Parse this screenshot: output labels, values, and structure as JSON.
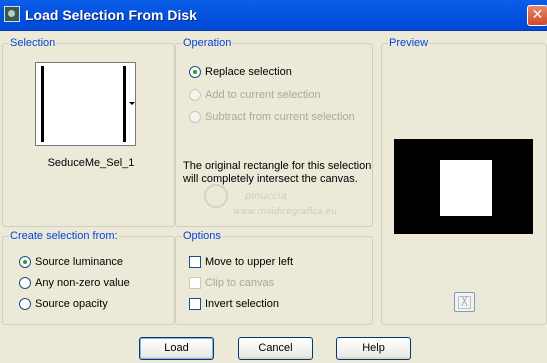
{
  "window": {
    "title": "Load Selection From Disk",
    "close_label": "✕"
  },
  "selection": {
    "legend": "Selection",
    "file_name": "SeduceMe_Sel_1"
  },
  "operation": {
    "legend": "Operation",
    "options": [
      {
        "label": "Replace selection",
        "checked": true,
        "enabled": true
      },
      {
        "label": "Add to current selection",
        "checked": false,
        "enabled": false
      },
      {
        "label": "Subtract from current selection",
        "checked": false,
        "enabled": false
      }
    ],
    "description": "The original rectangle for this selection will completely intersect the canvas."
  },
  "preview": {
    "legend": "Preview"
  },
  "create_from": {
    "legend": "Create selection from:",
    "options": [
      {
        "label": "Source luminance",
        "checked": true
      },
      {
        "label": "Any non-zero value",
        "checked": false
      },
      {
        "label": "Source opacity",
        "checked": false
      }
    ]
  },
  "options": {
    "legend": "Options",
    "items": [
      {
        "label": "Move to upper left",
        "checked": false,
        "enabled": true
      },
      {
        "label": "Clip to canvas",
        "checked": false,
        "enabled": false
      },
      {
        "label": "Invert selection",
        "checked": false,
        "enabled": true
      }
    ]
  },
  "buttons": {
    "load": "Load",
    "cancel": "Cancel",
    "help": "Help"
  },
  "watermark": {
    "line1": "pinuccia",
    "line2": "www.maidiregrafica.eu"
  },
  "icons": {
    "app": "app-icon",
    "close": "close-icon",
    "dropdown": "chevron-down-icon",
    "preview_toggle": "zoom-toggle-icon"
  }
}
